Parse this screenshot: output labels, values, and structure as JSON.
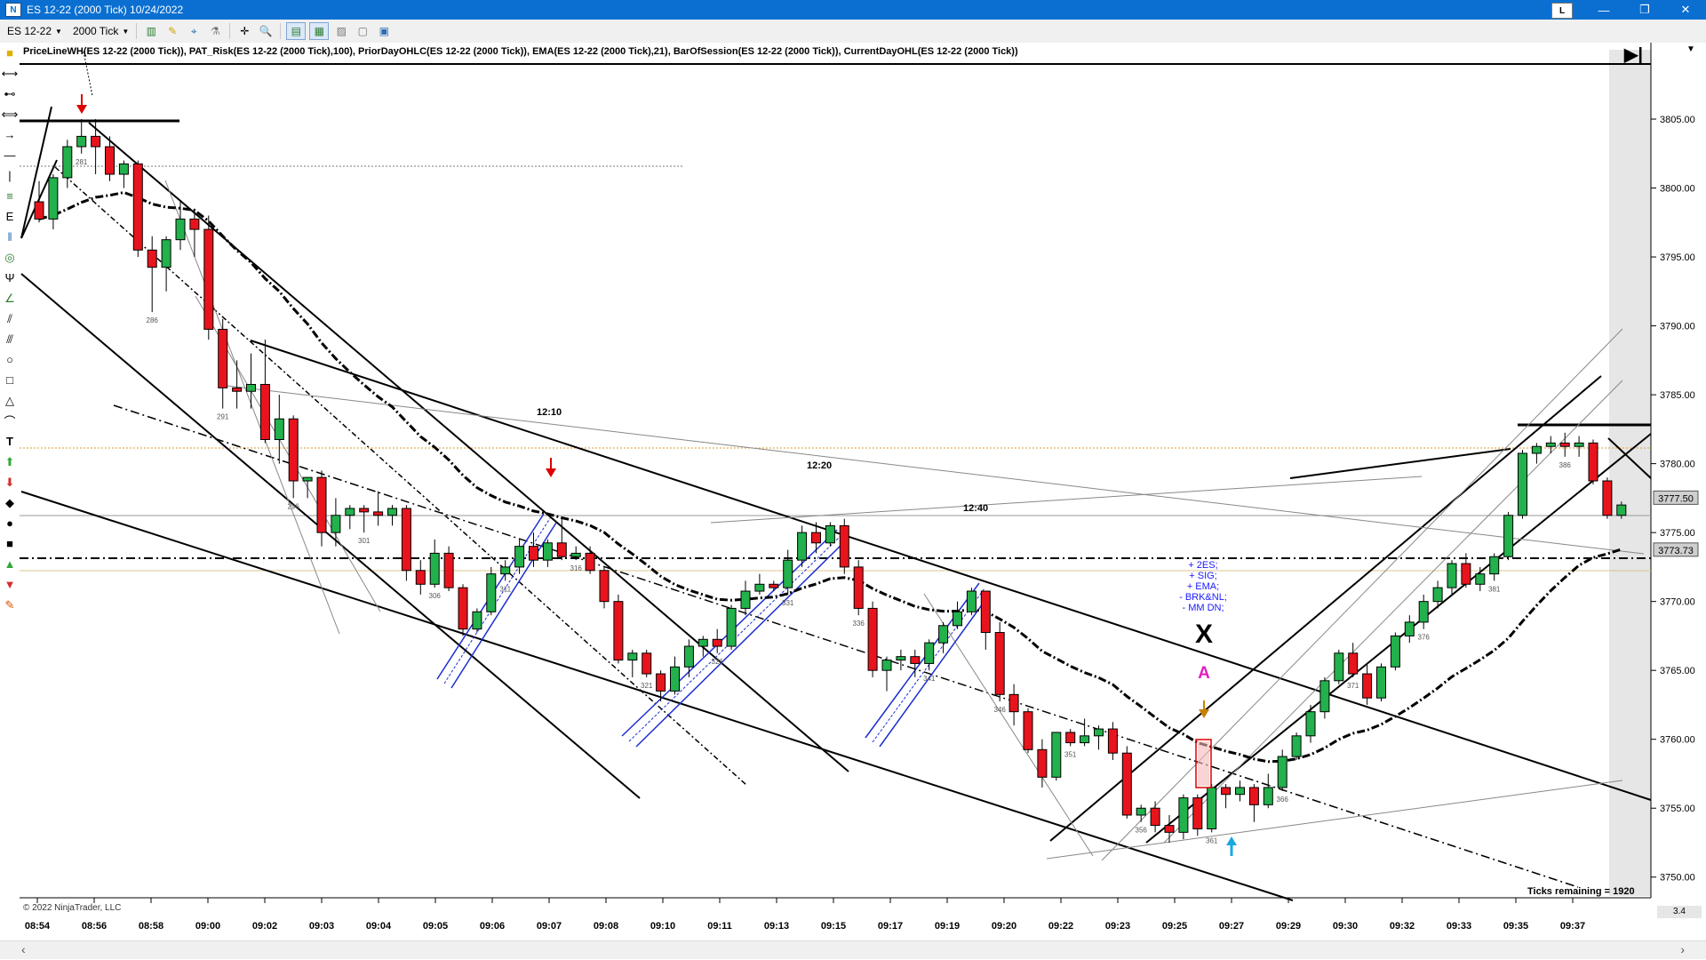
{
  "window": {
    "title": "ES 12-22 (2000 Tick)  10/24/2022",
    "lock_label": "L",
    "minimize": "—",
    "restore": "❐",
    "close": "✕"
  },
  "toolbar": {
    "instrument": "ES 12-22",
    "interval": "2000 Tick"
  },
  "indicators_text": "PriceLineWH(ES 12-22 (2000 Tick)), PAT_Risk(ES 12-22 (2000 Tick),100), PriorDayOHLC(ES 12-22 (2000 Tick)), EMA(ES 12-22 (2000 Tick),21), BarOfSession(ES 12-22 (2000 Tick)), CurrentDayOHL(ES 12-22 (2000 Tick))",
  "copyright": "© 2022 NinjaTrader, LLC",
  "ticks_remaining": "Ticks remaining = 1920",
  "scroll_right_label": "3.4",
  "price_markers": [
    {
      "label": "3777.50",
      "value": 3777.5
    },
    {
      "label": "3773.73",
      "value": 3773.73
    }
  ],
  "annotations": {
    "time_labels": [
      "12:10",
      "12:20",
      "12:40"
    ],
    "signal_text": [
      "+ 2ES;",
      "+ SIG;",
      "+ EMA;",
      "- BRK&NL;",
      "- MM DN;"
    ],
    "x_mark": "X",
    "a_mark": "A",
    "bar_numbers": [
      "281",
      "286",
      "291",
      "296",
      "301",
      "306",
      "311",
      "316",
      "321",
      "326",
      "331",
      "336",
      "341",
      "346",
      "351",
      "356",
      "361",
      "366",
      "371",
      "376",
      "381",
      "386"
    ]
  },
  "chart_data": {
    "type": "candlestick",
    "title": "",
    "ylim": [
      3748.5,
      3809.0
    ],
    "y_ticks": [
      3805,
      3800,
      3795,
      3790,
      3785,
      3780,
      3775,
      3770,
      3765,
      3760,
      3755,
      3750
    ],
    "y_tick_labels": [
      "3805.00",
      "3800.00",
      "3795.00",
      "3790.00",
      "3785.00",
      "3780.00",
      "3775.00",
      "3770.00",
      "3765.00",
      "3760.00",
      "3755.00",
      "3750.00"
    ],
    "x_tick_labels": [
      "08:54",
      "08:56",
      "08:58",
      "09:00",
      "09:02",
      "09:03",
      "09:04",
      "09:05",
      "09:06",
      "09:07",
      "09:08",
      "09:10",
      "09:11",
      "09:13",
      "09:15",
      "09:17",
      "09:19",
      "09:20",
      "09:22",
      "09:23",
      "09:25",
      "09:27",
      "09:29",
      "09:30",
      "09:32",
      "09:33",
      "09:35",
      "09:37"
    ],
    "ohlc": [
      [
        3799,
        3800.5,
        3797.5,
        3797.75
      ],
      [
        3797.75,
        3801,
        3797,
        3800.75
      ],
      [
        3800.75,
        3803.5,
        3800,
        3803
      ],
      [
        3803,
        3805,
        3802.5,
        3803.75
      ],
      [
        3803.75,
        3805,
        3801,
        3803
      ],
      [
        3803,
        3803.75,
        3800.5,
        3801
      ],
      [
        3801,
        3802,
        3800,
        3801.75
      ],
      [
        3801.75,
        3802,
        3795,
        3795.5
      ],
      [
        3795.5,
        3796.5,
        3791,
        3794.25
      ],
      [
        3794.25,
        3796.5,
        3792.5,
        3796.25
      ],
      [
        3796.25,
        3799,
        3795.5,
        3797.75
      ],
      [
        3797.75,
        3798.5,
        3795,
        3797
      ],
      [
        3797,
        3798,
        3789,
        3789.75
      ],
      [
        3789.75,
        3790.5,
        3784,
        3785.5
      ],
      [
        3785.5,
        3787.5,
        3784,
        3785.25
      ],
      [
        3785.25,
        3788,
        3784,
        3785.75
      ],
      [
        3785.75,
        3789,
        3781.5,
        3781.75
      ],
      [
        3781.75,
        3785,
        3780,
        3783.25
      ],
      [
        3783.25,
        3783.5,
        3777.5,
        3778.75
      ],
      [
        3778.75,
        3779,
        3777.5,
        3779
      ],
      [
        3779,
        3779.5,
        3774,
        3775
      ],
      [
        3775,
        3777.5,
        3774,
        3776.25
      ],
      [
        3776.25,
        3777,
        3775.25,
        3776.75
      ],
      [
        3776.75,
        3777,
        3775,
        3776.5
      ],
      [
        3776.5,
        3778,
        3775.5,
        3776.25
      ],
      [
        3776.25,
        3777,
        3775.5,
        3776.75
      ],
      [
        3776.75,
        3777,
        3771.5,
        3772.25
      ],
      [
        3772.25,
        3773,
        3770.5,
        3771.25
      ],
      [
        3771.25,
        3774.5,
        3771,
        3773.5
      ],
      [
        3773.5,
        3774,
        3770.75,
        3771
      ],
      [
        3771,
        3771.25,
        3767.5,
        3768
      ],
      [
        3768,
        3769.5,
        3767.75,
        3769.25
      ],
      [
        3769.25,
        3772.5,
        3769,
        3772
      ],
      [
        3772,
        3773,
        3771.5,
        3772.5
      ],
      [
        3772.5,
        3774.5,
        3772,
        3774
      ],
      [
        3774,
        3775,
        3772.5,
        3773
      ],
      [
        3773,
        3774.5,
        3772.5,
        3774.25
      ],
      [
        3774.25,
        3776,
        3773,
        3773.25
      ],
      [
        3773.25,
        3774,
        3773,
        3773.5
      ],
      [
        3773.5,
        3774,
        3772,
        3772.25
      ],
      [
        3772.25,
        3772.5,
        3769.5,
        3770
      ],
      [
        3770,
        3770.5,
        3765.5,
        3765.75
      ],
      [
        3765.75,
        3766.5,
        3764.5,
        3766.25
      ],
      [
        3766.25,
        3766.5,
        3764.5,
        3764.75
      ],
      [
        3764.75,
        3765,
        3762.75,
        3763.5
      ],
      [
        3763.5,
        3766,
        3763.25,
        3765.25
      ],
      [
        3765.25,
        3767.25,
        3764.5,
        3766.75
      ],
      [
        3766.75,
        3767.5,
        3766,
        3767.25
      ],
      [
        3767.25,
        3768,
        3766.25,
        3766.75
      ],
      [
        3766.75,
        3769.75,
        3766.5,
        3769.5
      ],
      [
        3769.5,
        3771.5,
        3769,
        3770.75
      ],
      [
        3770.75,
        3772,
        3770.5,
        3771.25
      ],
      [
        3771.25,
        3771.5,
        3770.75,
        3771
      ],
      [
        3771,
        3773.75,
        3770.5,
        3773
      ],
      [
        3773,
        3775.5,
        3772.5,
        3775
      ],
      [
        3775,
        3775.75,
        3773.5,
        3774.25
      ],
      [
        3774.25,
        3775.75,
        3774,
        3775.5
      ],
      [
        3775.5,
        3776,
        3772,
        3772.5
      ],
      [
        3772.5,
        3773,
        3769,
        3769.5
      ],
      [
        3769.5,
        3770,
        3764.5,
        3765
      ],
      [
        3765,
        3766,
        3763.5,
        3765.75
      ],
      [
        3765.75,
        3766.5,
        3765,
        3766
      ],
      [
        3766,
        3766.5,
        3764.5,
        3765.5
      ],
      [
        3765.5,
        3767.25,
        3765,
        3767
      ],
      [
        3767,
        3768.5,
        3766.25,
        3768.25
      ],
      [
        3768.25,
        3770,
        3768,
        3769.25
      ],
      [
        3769.25,
        3771,
        3769,
        3770.75
      ],
      [
        3770.75,
        3770.75,
        3766.5,
        3767.75
      ],
      [
        3767.75,
        3768.5,
        3762.75,
        3763.25
      ],
      [
        3763.25,
        3764,
        3761,
        3762
      ],
      [
        3762,
        3762.25,
        3759,
        3759.25
      ],
      [
        3759.25,
        3760,
        3756.5,
        3757.25
      ],
      [
        3757.25,
        3760.5,
        3757,
        3760.5
      ],
      [
        3760.5,
        3760.75,
        3759.5,
        3759.75
      ],
      [
        3759.75,
        3761.5,
        3759.5,
        3760.25
      ],
      [
        3760.25,
        3761,
        3759.25,
        3760.75
      ],
      [
        3760.75,
        3761.25,
        3758.5,
        3759
      ],
      [
        3759,
        3759.5,
        3754.25,
        3754.5
      ],
      [
        3754.5,
        3755.25,
        3754,
        3755
      ],
      [
        3755,
        3755.5,
        3753.25,
        3753.75
      ],
      [
        3753.75,
        3754.5,
        3752.5,
        3753.25
      ],
      [
        3753.25,
        3756,
        3752.75,
        3755.75
      ],
      [
        3755.75,
        3756,
        3753,
        3753.5
      ],
      [
        3753.5,
        3756.75,
        3753.25,
        3756.5
      ],
      [
        3756.5,
        3756.75,
        3755,
        3756
      ],
      [
        3756,
        3757,
        3755.5,
        3756.5
      ],
      [
        3756.5,
        3756.75,
        3754,
        3755.25
      ],
      [
        3755.25,
        3757.5,
        3755,
        3756.5
      ],
      [
        3756.5,
        3759.25,
        3756.25,
        3758.75
      ],
      [
        3758.75,
        3760.5,
        3758.5,
        3760.25
      ],
      [
        3760.25,
        3762.5,
        3759.75,
        3762
      ],
      [
        3762,
        3764.5,
        3761.5,
        3764.25
      ],
      [
        3764.25,
        3766.5,
        3764,
        3766.25
      ],
      [
        3766.25,
        3767,
        3764.5,
        3764.75
      ],
      [
        3764.75,
        3765.5,
        3762.5,
        3763
      ],
      [
        3763,
        3765.5,
        3762.75,
        3765.25
      ],
      [
        3765.25,
        3767.75,
        3765,
        3767.5
      ],
      [
        3767.5,
        3769,
        3767,
        3768.5
      ],
      [
        3768.5,
        3770.5,
        3768,
        3770
      ],
      [
        3770,
        3771.5,
        3769.5,
        3771
      ],
      [
        3771,
        3773,
        3770.5,
        3772.75
      ],
      [
        3772.75,
        3773.5,
        3771,
        3771.25
      ],
      [
        3771.25,
        3772.5,
        3770.75,
        3772
      ],
      [
        3772,
        3773.5,
        3771.5,
        3773.25
      ],
      [
        3773.25,
        3776.5,
        3773,
        3776.25
      ],
      [
        3776.25,
        3781,
        3776,
        3780.75
      ],
      [
        3780.75,
        3781.5,
        3780,
        3781.25
      ],
      [
        3781.25,
        3782,
        3780.75,
        3781.5
      ],
      [
        3781.5,
        3782.25,
        3780.5,
        3781.25
      ],
      [
        3781.25,
        3782,
        3780.5,
        3781.5
      ],
      [
        3781.5,
        3781.75,
        3778.5,
        3778.75
      ],
      [
        3778.75,
        3779,
        3776,
        3776.25
      ],
      [
        3776.25,
        3777.25,
        3776,
        3777
      ]
    ]
  }
}
